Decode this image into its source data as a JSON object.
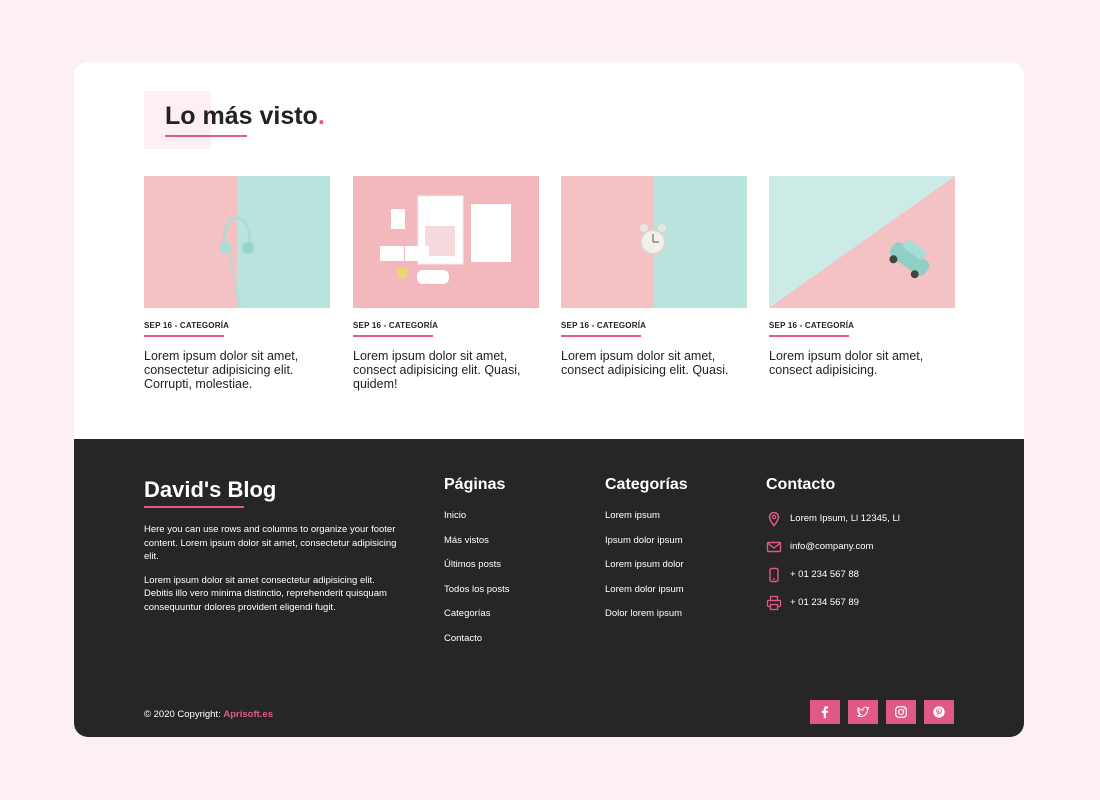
{
  "section": {
    "title": "Lo más visto",
    "title_dot": "."
  },
  "posts": [
    {
      "meta": "SEP 16 - CATEGORÍA",
      "excerpt": "Lorem ipsum dolor sit amet, consectetur adipisicing elit. Corrupti, molestiae.",
      "image": "headphones"
    },
    {
      "meta": "SEP 16 - CATEGORÍA",
      "excerpt": "Lorem ipsum dolor sit amet, consect adipisicing elit. Quasi, quidem!",
      "image": "stationery"
    },
    {
      "meta": "SEP 16 - CATEGORÍA",
      "excerpt": "Lorem ipsum dolor sit amet, consect adipisicing elit. Quasi.",
      "image": "alarm-clock"
    },
    {
      "meta": "SEP 16 - CATEGORÍA",
      "excerpt": "Lorem ipsum dolor sit amet, consect adipisicing.",
      "image": "toy-car"
    }
  ],
  "footer": {
    "brand": "David's Blog",
    "about": [
      "Here you can use rows and columns to organize your footer content. Lorem ipsum dolor sit amet, consectetur adipisicing elit.",
      "Lorem ipsum dolor sit amet consectetur adipisicing elit. Debitis illo vero minima distinctio, reprehenderit quisquam consequuntur dolores provident eligendi fugit."
    ],
    "pages": {
      "title": "Páginas",
      "items": [
        "Inicio",
        "Más vistos",
        "Últimos posts",
        "Todos los posts",
        "Categorías",
        "Contacto"
      ]
    },
    "categories": {
      "title": "Categorías",
      "items": [
        "Lorem ipsum",
        "Ipsum dolor ipsum",
        "Lorem ipsum dolor",
        "Lorem dolor ipsum",
        "Dolor lorem ipsum"
      ]
    },
    "contact": {
      "title": "Contacto",
      "items": [
        {
          "icon": "location-pin-icon",
          "text": "Lorem Ipsum, Ll 12345, Ll"
        },
        {
          "icon": "envelope-icon",
          "text": "info@company.com"
        },
        {
          "icon": "phone-icon",
          "text": "+ 01 234 567 88"
        },
        {
          "icon": "printer-icon",
          "text": "+ 01 234 567 89"
        }
      ]
    },
    "copyright": "© 2020 Copyright:",
    "copyright_link": "Aprisoft.es",
    "socials": [
      "facebook-icon",
      "twitter-icon",
      "instagram-icon",
      "pinterest-icon"
    ]
  },
  "colors": {
    "accent": "#e05a85",
    "background": "#fdf0f4",
    "footer": "#262626",
    "pink": "#f4c1c4",
    "mint": "#b9e3dd"
  }
}
